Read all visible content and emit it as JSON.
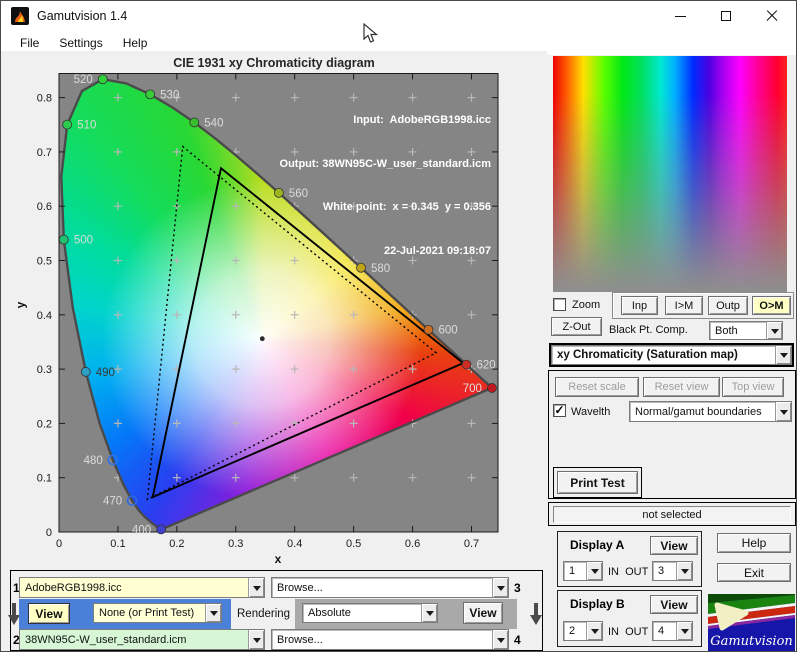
{
  "window": {
    "title": "Gamutvision 1.4"
  },
  "menu": {
    "file": "File",
    "settings": "Settings",
    "help": "Help"
  },
  "chart_data": {
    "type": "scatter",
    "subtype": "CIE 1931 xy chromaticity diagram",
    "title": "CIE 1931 xy Chromaticity diagram",
    "xlabel": "x",
    "ylabel": "y",
    "xlim": [
      0,
      0.745
    ],
    "ylim": [
      0,
      0.845
    ],
    "xticks": [
      0,
      0.1,
      0.2,
      0.3,
      0.4,
      0.5,
      0.6,
      0.7
    ],
    "yticks": [
      0,
      0.1,
      0.2,
      0.3,
      0.4,
      0.5,
      0.6,
      0.7,
      0.8
    ],
    "grid_cross_x": [
      0.1,
      0.2,
      0.3,
      0.4,
      0.5,
      0.6,
      0.7
    ],
    "grid_cross_y": [
      0.1,
      0.2,
      0.3,
      0.4,
      0.5,
      0.6,
      0.7,
      0.8
    ],
    "annotations": [
      "Input:  AdobeRGB1998.icc",
      "Output: 38WN95C-W_user_standard.icm",
      "White point:  x = 0.345  y = 0.356",
      "22-Jul-2021 09:18:07"
    ],
    "white_point": {
      "x": 0.345,
      "y": 0.356
    },
    "series": [
      {
        "name": "Input gamut AdobeRGB1998.icc",
        "style": "dotted",
        "points": [
          [
            0.64,
            0.33
          ],
          [
            0.21,
            0.71
          ],
          [
            0.15,
            0.06
          ]
        ]
      },
      {
        "name": "Output gamut 38WN95C-W_user_standard.icm",
        "style": "solid",
        "points": [
          [
            0.686,
            0.311
          ],
          [
            0.275,
            0.67
          ],
          [
            0.159,
            0.064
          ]
        ]
      }
    ],
    "wavelength_markers": [
      {
        "nm": 400,
        "x": 0.1733,
        "y": 0.0048,
        "color": "#4040d0",
        "label_side": "left",
        "open": false,
        "label_color": "#dcdcdc"
      },
      {
        "nm": 470,
        "x": 0.1241,
        "y": 0.0578,
        "color": "#2e6ae6",
        "label_side": "left",
        "open": true,
        "label_color": "#dcdcdc"
      },
      {
        "nm": 480,
        "x": 0.0913,
        "y": 0.1327,
        "color": "#2f74e8",
        "label_side": "left",
        "open": true,
        "label_color": "#dcdcdc"
      },
      {
        "nm": 490,
        "x": 0.0454,
        "y": 0.295,
        "color": "#2da0c8",
        "label_side": "right",
        "open": false,
        "label_color": "#3a3a3a"
      },
      {
        "nm": 500,
        "x": 0.0082,
        "y": 0.5384,
        "color": "#1fc06e",
        "label_side": "right",
        "open": false,
        "label_color": "#dcdcdc"
      },
      {
        "nm": 510,
        "x": 0.0139,
        "y": 0.7502,
        "color": "#2ecc4e",
        "label_side": "right",
        "open": false,
        "label_color": "#dcdcdc"
      },
      {
        "nm": 520,
        "x": 0.0743,
        "y": 0.8338,
        "color": "#30d23a",
        "label_side": "left",
        "open": false,
        "label_color": "#dcdcdc"
      },
      {
        "nm": 530,
        "x": 0.1547,
        "y": 0.8059,
        "color": "#38cc38",
        "label_side": "right",
        "open": false,
        "label_color": "#dcdcdc"
      },
      {
        "nm": 540,
        "x": 0.2296,
        "y": 0.7543,
        "color": "#3bbe2e",
        "label_side": "right",
        "open": false,
        "label_color": "#dcdcdc"
      },
      {
        "nm": 560,
        "x": 0.3731,
        "y": 0.6245,
        "color": "#9cb41e",
        "label_side": "right",
        "open": false,
        "label_color": "#dcdcdc"
      },
      {
        "nm": 580,
        "x": 0.5125,
        "y": 0.4866,
        "color": "#c0a418",
        "label_side": "right",
        "open": false,
        "label_color": "#dcdcdc"
      },
      {
        "nm": 600,
        "x": 0.627,
        "y": 0.3725,
        "color": "#cc6e24",
        "label_side": "right",
        "open": false,
        "label_color": "#dcdcdc"
      },
      {
        "nm": 620,
        "x": 0.6915,
        "y": 0.3083,
        "color": "#cc2c24",
        "label_side": "right",
        "open": false,
        "label_color": "#dcdcdc"
      },
      {
        "nm": 700,
        "x": 0.7347,
        "y": 0.2653,
        "color": "#c01820",
        "label_side": "left",
        "open": false,
        "label_color": "#dcdcdc"
      }
    ],
    "spectral_locus": [
      [
        0.1741,
        0.005
      ],
      [
        0.1703,
        0.0058
      ],
      [
        0.1689,
        0.0069
      ],
      [
        0.1669,
        0.0086
      ],
      [
        0.1644,
        0.0109
      ],
      [
        0.1611,
        0.0138
      ],
      [
        0.1566,
        0.0177
      ],
      [
        0.151,
        0.0227
      ],
      [
        0.144,
        0.0297
      ],
      [
        0.1355,
        0.0399
      ],
      [
        0.1241,
        0.0578
      ],
      [
        0.1096,
        0.0868
      ],
      [
        0.0913,
        0.1327
      ],
      [
        0.0687,
        0.2007
      ],
      [
        0.0454,
        0.295
      ],
      [
        0.0235,
        0.4127
      ],
      [
        0.0082,
        0.5384
      ],
      [
        0.0039,
        0.6548
      ],
      [
        0.0139,
        0.7502
      ],
      [
        0.0389,
        0.812
      ],
      [
        0.0743,
        0.8338
      ],
      [
        0.1142,
        0.8262
      ],
      [
        0.1547,
        0.8059
      ],
      [
        0.1929,
        0.7816
      ],
      [
        0.2296,
        0.7543
      ],
      [
        0.2658,
        0.7243
      ],
      [
        0.3016,
        0.6923
      ],
      [
        0.3373,
        0.6589
      ],
      [
        0.3731,
        0.6245
      ],
      [
        0.4087,
        0.5896
      ],
      [
        0.4441,
        0.5547
      ],
      [
        0.4788,
        0.5202
      ],
      [
        0.5125,
        0.4866
      ],
      [
        0.5448,
        0.4544
      ],
      [
        0.5752,
        0.4242
      ],
      [
        0.6029,
        0.3965
      ],
      [
        0.627,
        0.3725
      ],
      [
        0.6482,
        0.3514
      ],
      [
        0.6658,
        0.334
      ],
      [
        0.6801,
        0.3197
      ],
      [
        0.6915,
        0.3083
      ],
      [
        0.7079,
        0.292
      ],
      [
        0.719,
        0.2809
      ],
      [
        0.726,
        0.274
      ],
      [
        0.7327,
        0.2673
      ],
      [
        0.7347,
        0.2653
      ]
    ]
  },
  "right_panel": {
    "zoom_checkbox": "Zoom",
    "btn_inp": "Inp",
    "btn_im": "I>M",
    "btn_outp": "Outp",
    "btn_om": "O>M",
    "z_out": "Z-Out",
    "black_pt_label": "Black Pt. Comp.",
    "black_pt_value": "Both",
    "map_select": "xy Chromaticity (Saturation map)",
    "reset_scale": "Reset scale",
    "reset_view": "Reset view",
    "top_view": "Top view",
    "wavelth_checkbox": "Wavelth",
    "wavelth_value": "Normal/gamut boundaries",
    "print_test": "Print Test",
    "status": "not selected",
    "display_a": {
      "label": "Display A",
      "view": "View",
      "in": "1",
      "inout": "IN  OUT",
      "out": "3"
    },
    "display_b": {
      "label": "Display B",
      "view": "View",
      "in": "2",
      "inout": "IN  OUT",
      "out": "4"
    },
    "help": "Help",
    "exit": "Exit",
    "logo_text": "Gamutvision"
  },
  "bottom_panel": {
    "row1": {
      "num": "1",
      "profile": "AdobeRGB1998.icc",
      "browse": "Browse...",
      "num_right": "3"
    },
    "mid": {
      "view_a": "View",
      "printer_profile": "None (or Print Test)",
      "rendering_label": "Rendering",
      "rendering_value": "Absolute",
      "view_b": "View"
    },
    "row2": {
      "num": "2",
      "profile": "38WN95C-W_user_standard.icm",
      "browse": "Browse...",
      "num_right": "4"
    }
  },
  "colors": {
    "accent_blue": "#4a80d8",
    "highlight_yellow": "#ffffc4",
    "field_yellow": "#ffffd2",
    "field_green": "#d6f6d6",
    "plot_bg": "#858585"
  }
}
